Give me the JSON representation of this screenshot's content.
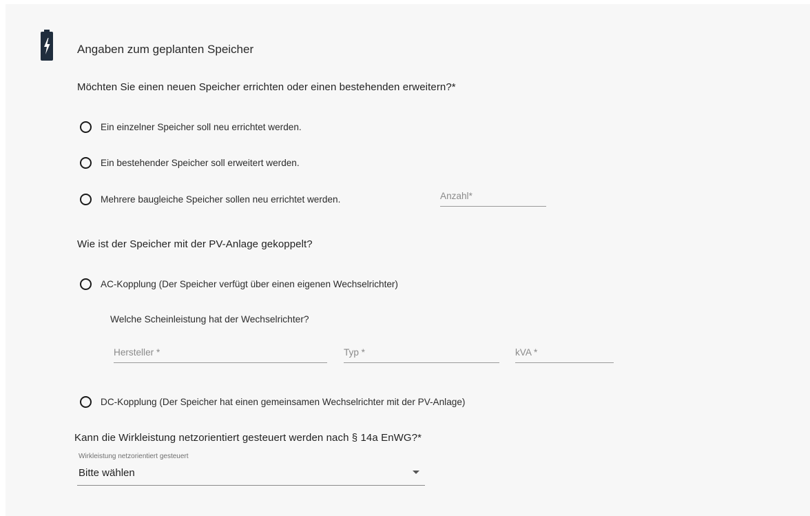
{
  "section": {
    "title": "Angaben zum geplanten Speicher",
    "icon": "battery-charging-icon"
  },
  "question_new_or_extend": {
    "label": "Möchten Sie einen neuen Speicher errichten oder einen bestehenden erweitern?*",
    "options": [
      "Ein einzelner Speicher soll neu errichtet werden.",
      "Ein bestehender Speicher soll erweitert werden.",
      "Mehrere baugleiche Speicher sollen neu errichtet werden."
    ],
    "count_placeholder": "Anzahl*"
  },
  "question_coupling": {
    "label": "Wie ist der Speicher mit der PV-Anlage gekoppelt?",
    "ac_option": "AC-Kopplung (Der Speicher verfügt über einen eigenen Wechselrichter)",
    "inverter_question": "Welche Scheinleistung hat der Wechselrichter?",
    "manufacturer_placeholder": "Hersteller *",
    "type_placeholder": "Typ *",
    "kva_placeholder": "kVA *",
    "dc_option": "DC-Kopplung (Der Speicher hat einen gemeinsamen Wechselrichter mit der PV-Anlage)"
  },
  "question_control": {
    "label": "Kann die Wirkleistung netzorientiert gesteuert werden nach § 14a EnWG?*",
    "select_label": "Wirkleistung netzorientiert gesteuert",
    "select_value": "Bitte wählen"
  },
  "colors": {
    "card_background": "#f7f7f7",
    "icon_color": "#1f2d3d",
    "text": "#222222"
  }
}
